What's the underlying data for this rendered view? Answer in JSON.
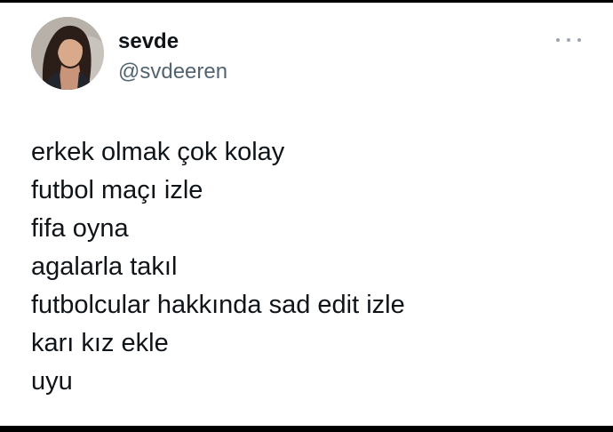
{
  "tweet": {
    "author": {
      "display_name": "sevde",
      "handle": "@svdeeren",
      "avatar_icon": "profile-photo"
    },
    "more_icon": "more-options-icon",
    "lines": [
      "erkek olmak çok kolay",
      "futbol maçı izle",
      "fifa oyna",
      "agalarla takıl",
      "futbolcular hakkında sad edit izle",
      "karı kız ekle",
      "uyu"
    ]
  },
  "colors": {
    "background": "#ffffff",
    "text": "#0f1419",
    "secondary_text": "#536471",
    "frame": "#000000"
  }
}
